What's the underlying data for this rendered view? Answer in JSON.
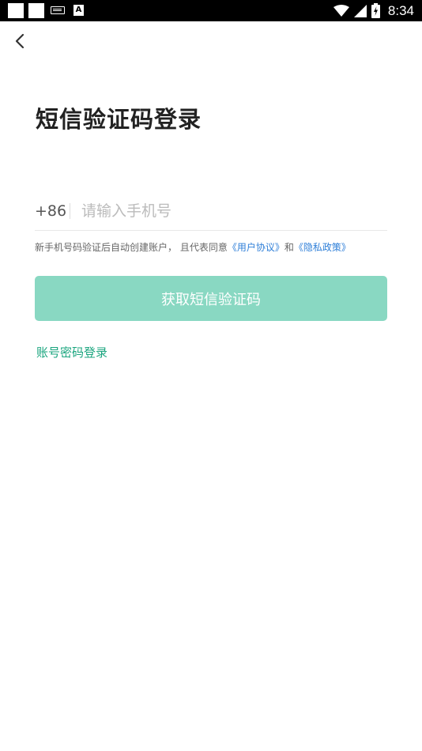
{
  "status_bar": {
    "time": "8:34",
    "icons": [
      "notification-square-icon",
      "notification-square-icon",
      "keyboard-icon",
      "a-app-icon",
      "wifi-icon",
      "signal-icon",
      "battery-charging-icon"
    ]
  },
  "header": {
    "back_icon": "chevron-left-icon"
  },
  "login": {
    "title": "短信验证码登录",
    "country_code": "+86",
    "phone_placeholder": "请输入手机号",
    "phone_value": "",
    "agreement_prefix": "新手机号码验证后自动创建账户， 且代表同意",
    "user_agreement_link": "《用户协议》",
    "agreement_and": "和",
    "privacy_link": "《隐私政策》",
    "submit_label": "获取短信验证码",
    "alt_login_label": "账号密码登录"
  },
  "colors": {
    "accent": "#1aa57e",
    "button_disabled": "#89d8c2",
    "link": "#2f7fd8"
  }
}
